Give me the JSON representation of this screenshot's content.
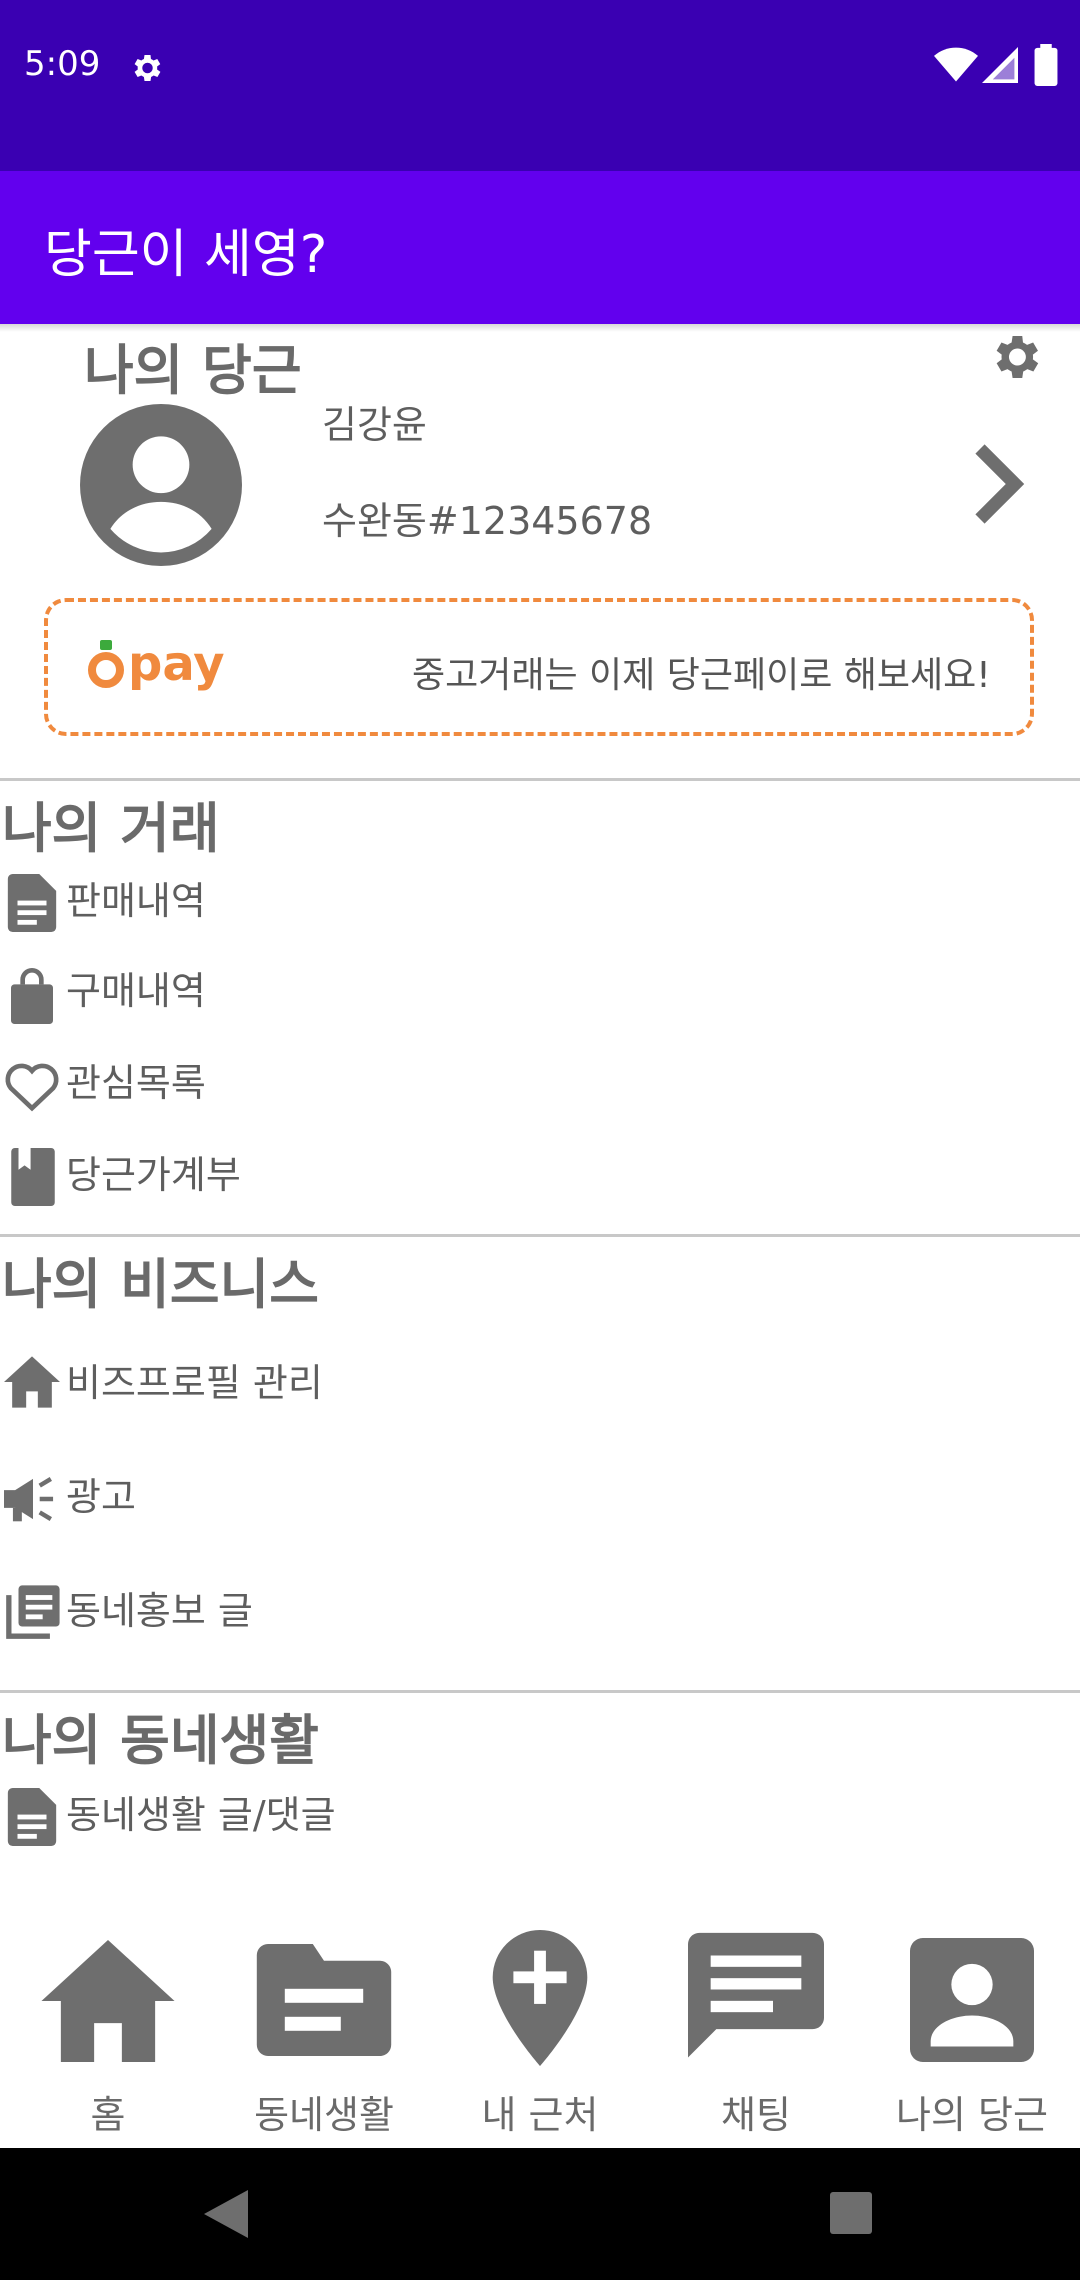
{
  "status_bar": {
    "time": "5:09"
  },
  "app_bar": {
    "title": "당근이 세영?"
  },
  "profile": {
    "section_title": "나의 당근",
    "name": "김강윤",
    "location": "수완동#12345678"
  },
  "pay_banner": {
    "logo_text": "pay",
    "message": "중고거래는 이제 당근페이로 해보세요!"
  },
  "trade": {
    "title": "나의 거래",
    "items": [
      {
        "label": "판매내역",
        "icon": "document-icon"
      },
      {
        "label": "구매내역",
        "icon": "shopping-bag-icon"
      },
      {
        "label": "관심목록",
        "icon": "heart-icon"
      },
      {
        "label": "당근가계부",
        "icon": "book-icon"
      }
    ]
  },
  "business": {
    "title": "나의 비즈니스",
    "items": [
      {
        "label": "비즈프로필 관리",
        "icon": "home-icon"
      },
      {
        "label": "광고",
        "icon": "megaphone-icon"
      },
      {
        "label": "동네홍보 글",
        "icon": "articles-icon"
      }
    ]
  },
  "neighborhood": {
    "title": "나의 동네생활",
    "items": [
      {
        "label": "동네생활 글/댓글",
        "icon": "document-icon"
      }
    ]
  },
  "bottom_nav": {
    "items": [
      {
        "label": "홈",
        "icon": "home-icon"
      },
      {
        "label": "동네생활",
        "icon": "folder-icon"
      },
      {
        "label": "내 근처",
        "icon": "location-add-icon"
      },
      {
        "label": "채팅",
        "icon": "chat-icon"
      },
      {
        "label": "나의 당근",
        "icon": "account-box-icon"
      }
    ]
  },
  "colors": {
    "status_bar": "#3a00b2",
    "app_bar": "#6200ee",
    "pay_border": "#f08a3e",
    "icon_gray": "#6e6e6e"
  }
}
